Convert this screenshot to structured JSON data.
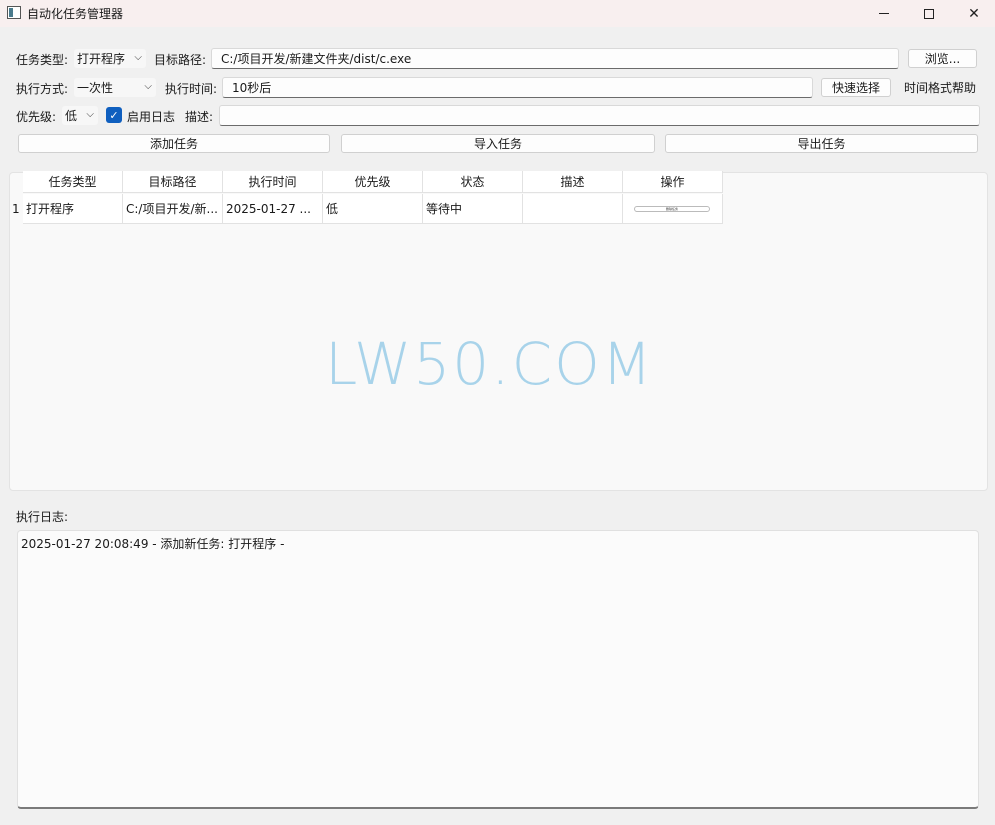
{
  "window": {
    "title": "自动化任务管理器"
  },
  "form": {
    "task_type_label": "任务类型:",
    "task_type_value": "打开程序",
    "target_path_label": "目标路径:",
    "target_path_value": "C:/项目开发/新建文件夹/dist/c.exe",
    "browse_button": "浏览...",
    "exec_mode_label": "执行方式:",
    "exec_mode_value": "一次性",
    "exec_time_label": "执行时间:",
    "exec_time_value": "10秒后",
    "quick_select_button": "快速选择",
    "time_help_button": "时间格式帮助",
    "priority_label": "优先级:",
    "priority_value": "低",
    "enable_log_label": "启用日志",
    "enable_log_checked": true,
    "description_label": "描述:",
    "description_value": ""
  },
  "actions": {
    "add_task": "添加任务",
    "import_task": "导入任务",
    "export_task": "导出任务"
  },
  "table": {
    "headers": [
      "任务类型",
      "目标路径",
      "执行时间",
      "优先级",
      "状态",
      "描述",
      "操作"
    ],
    "rows": [
      {
        "index": "1",
        "task_type": "打开程序",
        "target_path": "C:/项目开发/新...",
        "exec_time": "2025-01-27 ...",
        "priority": "低",
        "status": "等待中",
        "description": "",
        "operation": "删除任务"
      }
    ]
  },
  "watermark": "LW50.COM",
  "log": {
    "label": "执行日志:",
    "entries": [
      "2025-01-27 20:08:49 - 添加新任务: 打开程序 -"
    ]
  }
}
